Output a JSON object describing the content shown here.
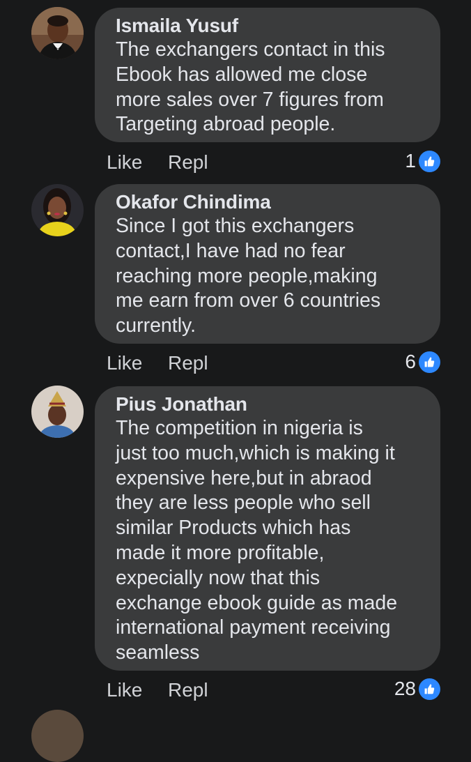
{
  "comments": [
    {
      "author": "Ismaila Yusuf",
      "text": "The exchangers contact in this\nEbook has allowed me close\nmore sales over 7 figures from\nTargeting abroad people.",
      "like_label": "Like",
      "reply_label": "Repl",
      "reaction_count": "1"
    },
    {
      "author": "Okafor Chindima",
      "text": "Since I got this exchangers\ncontact,I have had no fear\nreaching more people,making\nme earn from over 6 countries\ncurrently.",
      "like_label": "Like",
      "reply_label": "Repl",
      "reaction_count": "6"
    },
    {
      "author": "Pius Jonathan",
      "text": "The competition in nigeria is\njust too much,which is making it\nexpensive here,but in abraod\nthey are less people who sell\nsimilar Products which has\nmade it more profitable,\nexpecially now that this\nexchange ebook guide as made\ninternational payment receiving\nseamless",
      "like_label": "Like",
      "reply_label": "Repl",
      "reaction_count": "28"
    }
  ],
  "colors": {
    "background": "#18191a",
    "bubble": "#3a3b3c",
    "text": "#e4e6eb",
    "action_text": "#d0d2d6",
    "like_blue": "#2d88ff"
  },
  "icons": {
    "reaction": "thumbs-up-icon"
  }
}
